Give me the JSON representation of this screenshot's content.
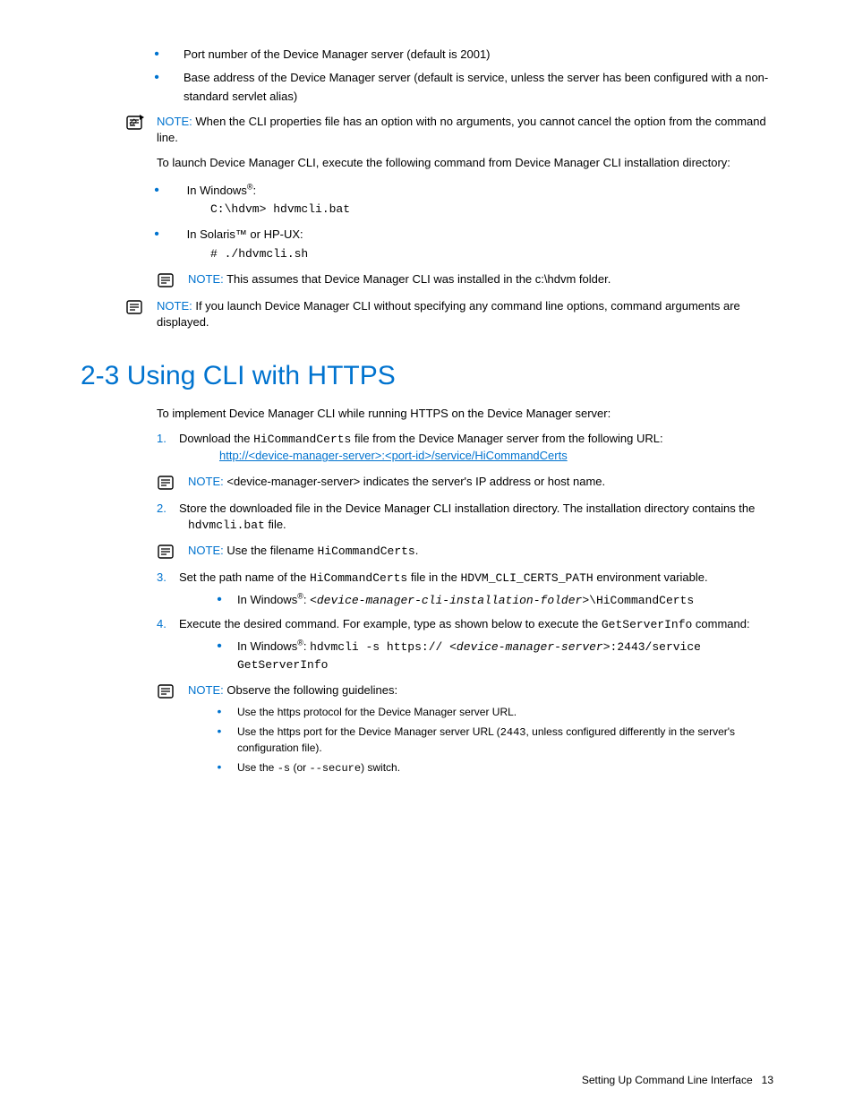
{
  "topBullets": {
    "items": [
      "Port number of the Device Manager server (default is 2001)",
      "Base address of the Device Manager server (default is service, unless the server has been configured with a non-standard servlet alias)"
    ]
  },
  "note1": {
    "label": "NOTE:",
    "text": " When the CLI properties file has an option with no arguments, you cannot cancel the option from the command line."
  },
  "launch": {
    "intro": "To launch Device Manager CLI, execute the following command from Device Manager CLI installation directory:",
    "winLabel": "In Windows",
    "winSup": "®",
    "winColon": ":",
    "winCmd": "C:\\hdvm> hdvmcli.bat",
    "solLabel": "In Solaris™ or HP-UX:",
    "solCmd": "# ./hdvmcli.sh"
  },
  "note2": {
    "label": "NOTE:",
    "text": " This assumes that Device Manager CLI was installed in the c:\\hdvm folder."
  },
  "note3": {
    "label": "NOTE:",
    "text": " If you launch Device Manager CLI without specifying any command line options, command arguments are displayed."
  },
  "section": {
    "heading": "2-3 Using CLI with HTTPS",
    "intro": "To implement Device Manager CLI while running HTTPS on the Device Manager server:"
  },
  "step1": {
    "num": "1.",
    "pre": "Download the ",
    "code": "HiCommandCerts",
    "post": " file from the Device Manager server from the following URL:",
    "link": "http://<device-manager-server>:<port-id>/service/HiCommandCerts"
  },
  "noteS1": {
    "label": "NOTE:",
    "text": " <device-manager-server> indicates the server's IP address or host name."
  },
  "step2": {
    "num": "2.",
    "pre": "Store the downloaded file in the Device Manager CLI installation directory. The installation directory contains the ",
    "code": "hdvmcli.bat",
    "post": " file."
  },
  "noteS2": {
    "label": "NOTE:",
    "pre": " Use the filename ",
    "code": "HiCommandCerts",
    "post": "."
  },
  "step3": {
    "num": "3.",
    "pre": "Set the path name of the ",
    "code1": "HiCommandCerts",
    "mid": " file in the ",
    "code2": "HDVM_CLI_CERTS_PATH",
    "post": " environment variable.",
    "bulletPre": "In Windows",
    "bulletSup": "®",
    "bulletColon": ": ",
    "bulletItal": "<device-manager-cli-installation-folder>",
    "bulletTail": "\\HiCommandCerts"
  },
  "step4": {
    "num": "4.",
    "pre": "Execute the desired command. For example, type as shown below to execute the ",
    "code": "GetServerInfo",
    "post": " command:",
    "bulletPre": "In Windows",
    "bulletSup": "®",
    "bulletColon": ": ",
    "bulletCode1": "hdvmcli -s https:// ",
    "bulletItal": "<device-manager-server>",
    "bulletCode2": ":2443/service GetServerInfo"
  },
  "noteG": {
    "label": "NOTE:",
    "text": " Observe the following guidelines:",
    "g1": "Use the https protocol for the Device Manager server URL.",
    "g2pre": "Use the https port for the Device Manager server URL (",
    "g2code": "2443",
    "g2post": ", unless configured differently in the server's configuration file).",
    "g3pre": "Use the ",
    "g3c1": "-s",
    "g3mid": " (or ",
    "g3c2": "--secure",
    "g3post": ") switch."
  },
  "footer": {
    "text": "Setting Up Command Line Interface",
    "page": "13"
  }
}
